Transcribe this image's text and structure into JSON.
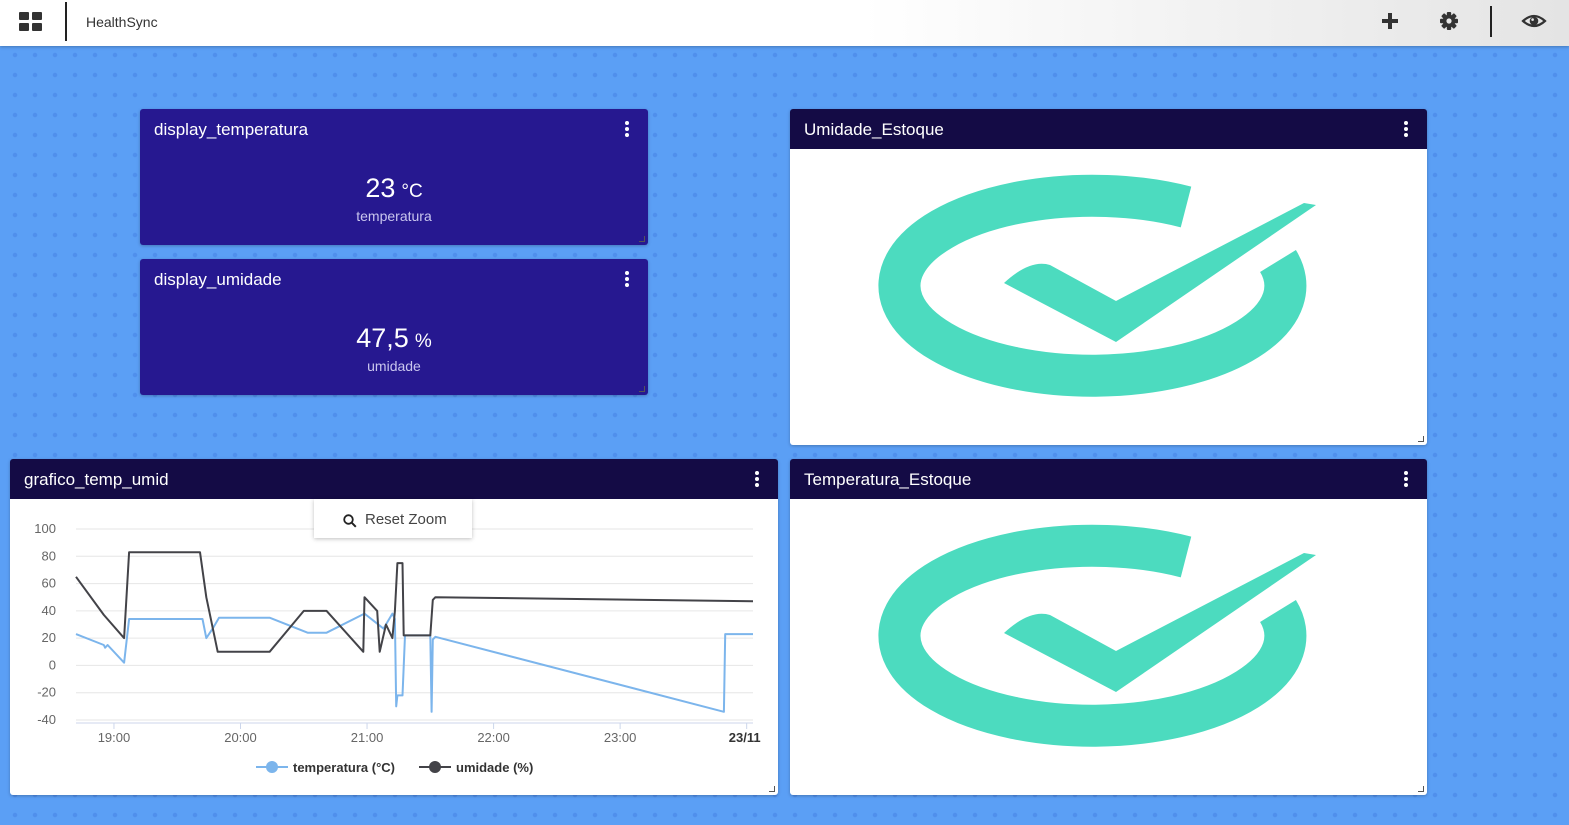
{
  "app": {
    "title": "HealthSync"
  },
  "toolbar": {
    "apps_icon": "grid-icon",
    "add_icon": "plus-icon",
    "settings_icon": "gear-icon",
    "view_icon": "eye-icon"
  },
  "widgets": {
    "temperature": {
      "title": "display_temperatura",
      "value": "23",
      "unit": "°C",
      "label": "temperatura"
    },
    "humidity": {
      "title": "display_umidade",
      "value": "47,5",
      "unit": "%",
      "label": "umidade"
    },
    "humidity_status": {
      "title": "Umidade_Estoque",
      "icon": "checkmark-icon",
      "color": "#4cdbbf"
    },
    "temperature_status": {
      "title": "Temperatura_Estoque",
      "icon": "checkmark-icon",
      "color": "#4cdbbf"
    },
    "chart": {
      "title": "grafico_temp_umid",
      "reset_zoom_label": "Reset Zoom"
    }
  },
  "colors": {
    "background": "#5b9ff5",
    "display_bg": "#261890",
    "header_dark": "#140b45",
    "temperature_series": "#7cb5ec",
    "humidity_series": "#434348"
  },
  "chart_data": {
    "type": "line",
    "title": "",
    "xlabel": "",
    "ylabel": "",
    "ylim": [
      -40,
      100
    ],
    "yticks": [
      100,
      80,
      60,
      40,
      20,
      0,
      -20,
      -40
    ],
    "xticks": [
      {
        "label": "19:00",
        "t": 19.0,
        "bold": false
      },
      {
        "label": "20:00",
        "t": 20.0,
        "bold": false
      },
      {
        "label": "21:00",
        "t": 21.0,
        "bold": false
      },
      {
        "label": "22:00",
        "t": 22.0,
        "bold": false
      },
      {
        "label": "23:00",
        "t": 23.0,
        "bold": false
      },
      {
        "label": "23/11",
        "t": 24.0,
        "bold": true
      }
    ],
    "xlim": [
      18.7,
      24.05
    ],
    "grid": true,
    "legend": "bottom",
    "series": [
      {
        "name": "temperatura (°C)",
        "color": "#7cb5ec",
        "points": [
          [
            18.7,
            23
          ],
          [
            18.92,
            15
          ],
          [
            18.93,
            13
          ],
          [
            18.95,
            15
          ],
          [
            19.08,
            2
          ],
          [
            19.12,
            34
          ],
          [
            19.7,
            34
          ],
          [
            19.73,
            20
          ],
          [
            19.78,
            27
          ],
          [
            19.83,
            35
          ],
          [
            20.23,
            35
          ],
          [
            20.53,
            24
          ],
          [
            20.68,
            24
          ],
          [
            20.98,
            38
          ],
          [
            21.13,
            27
          ],
          [
            21.2,
            38
          ],
          [
            21.22,
            34
          ],
          [
            21.23,
            -30
          ],
          [
            21.24,
            -22
          ],
          [
            21.28,
            -22
          ],
          [
            21.3,
            22
          ],
          [
            21.5,
            22
          ],
          [
            21.51,
            -34
          ],
          [
            21.52,
            19
          ],
          [
            21.54,
            21
          ],
          [
            23.82,
            -34
          ],
          [
            23.83,
            23
          ],
          [
            24.05,
            23
          ]
        ]
      },
      {
        "name": "umidade (%)",
        "color": "#434348",
        "points": [
          [
            18.7,
            65
          ],
          [
            18.92,
            37
          ],
          [
            19.08,
            20
          ],
          [
            19.12,
            83
          ],
          [
            19.68,
            83
          ],
          [
            19.73,
            50
          ],
          [
            19.82,
            10
          ],
          [
            20.23,
            10
          ],
          [
            20.5,
            40
          ],
          [
            20.68,
            40
          ],
          [
            20.97,
            10
          ],
          [
            20.98,
            50
          ],
          [
            21.08,
            40
          ],
          [
            21.1,
            10
          ],
          [
            21.15,
            30
          ],
          [
            21.2,
            20
          ],
          [
            21.22,
            40
          ],
          [
            21.24,
            75
          ],
          [
            21.28,
            75
          ],
          [
            21.29,
            22
          ],
          [
            21.5,
            22
          ],
          [
            21.52,
            48
          ],
          [
            21.54,
            50
          ],
          [
            24.05,
            47
          ]
        ]
      }
    ]
  }
}
